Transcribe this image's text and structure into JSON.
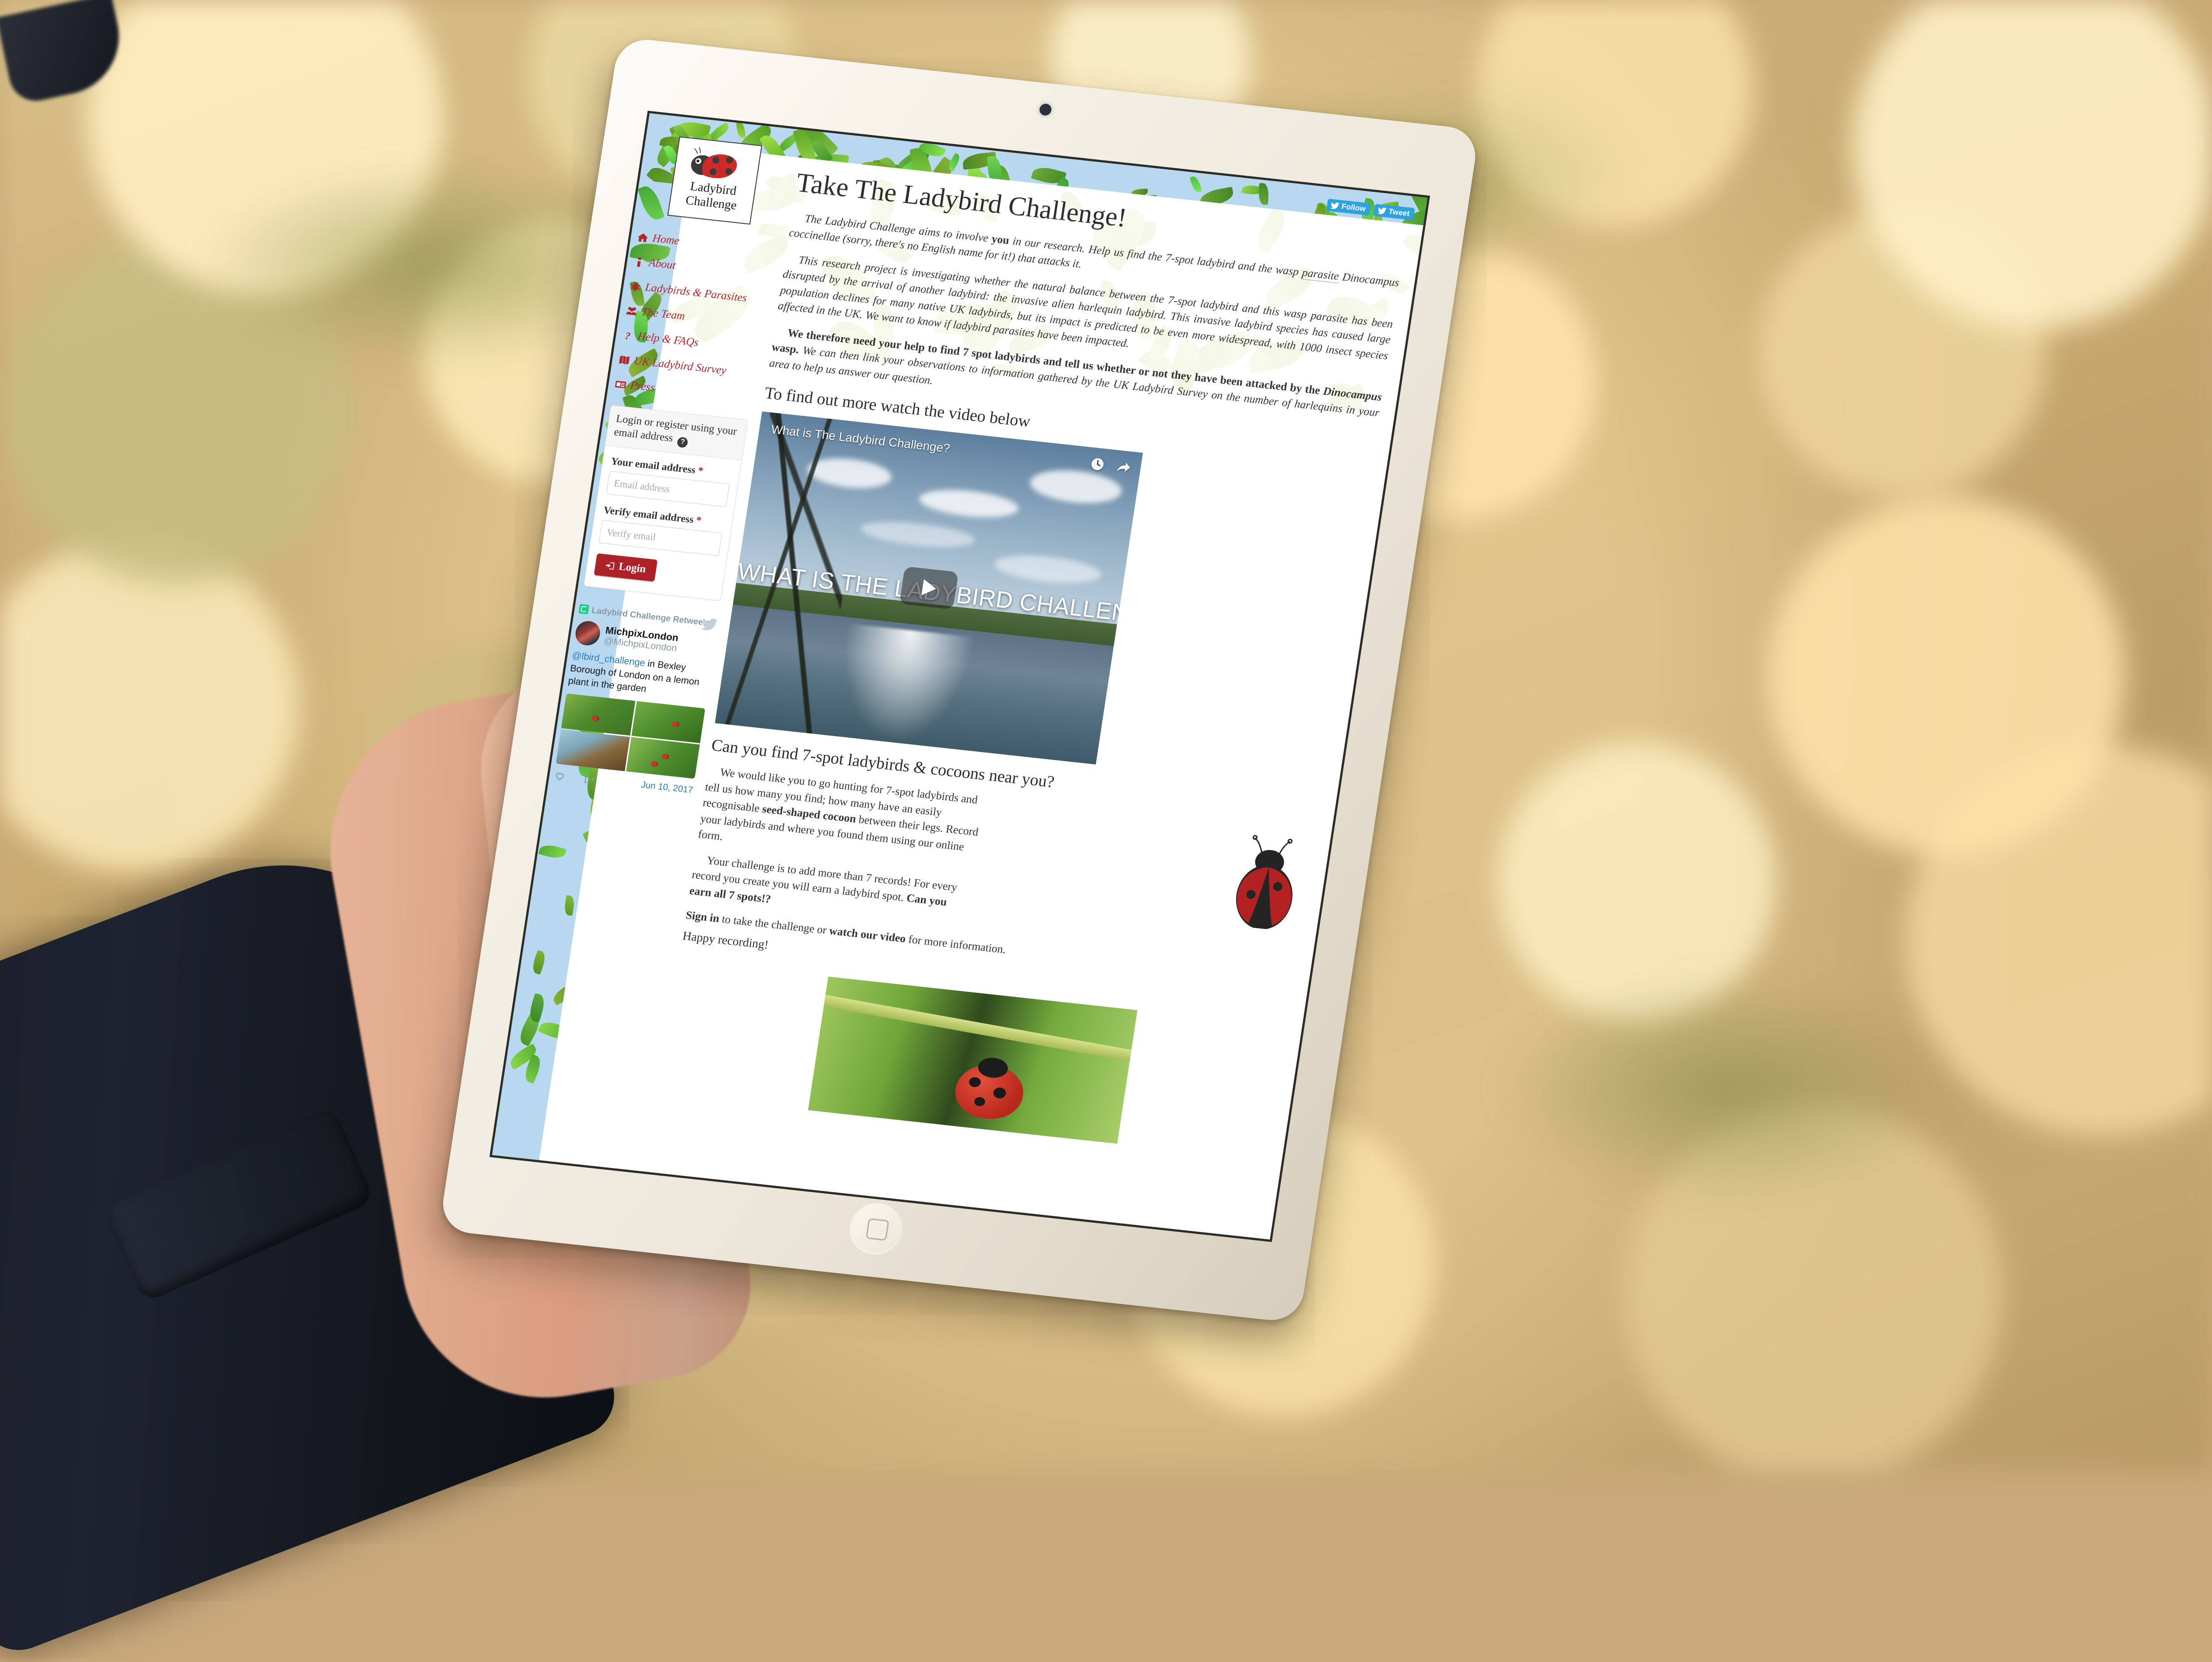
{
  "device": {
    "type": "tablet",
    "orientation": "portrait",
    "bezel_color": "#f1ebe0"
  },
  "site": {
    "logo": {
      "line1": "Ladybird",
      "line2": "Challenge",
      "alt": "ladybird-logo"
    },
    "social": {
      "follow_label": "Follow",
      "tweet_label": "Tweet",
      "button_color": "#2ca3e0"
    },
    "nav": [
      {
        "icon": "home-icon",
        "label": "Home"
      },
      {
        "icon": "info-icon",
        "label": "About"
      },
      {
        "icon": "bug-icon",
        "label": "Ladybirds & Parasites"
      },
      {
        "icon": "users-icon",
        "label": "The Team"
      },
      {
        "icon": "question-icon",
        "label": "Help & FAQs"
      },
      {
        "icon": "map-icon",
        "label": "UK Ladybird Survey"
      },
      {
        "icon": "newspaper-icon",
        "label": "Press"
      }
    ],
    "login": {
      "heading": "Login or register using your email address",
      "help_icon": "question-circle-icon",
      "email_label": "Your email address",
      "email_placeholder": "Email address",
      "verify_label": "Verify email address",
      "verify_placeholder": "Verify email",
      "required_marker": "*",
      "button_label": "Login",
      "button_color": "#ad2229"
    },
    "twitter_widget": {
      "retweet_line": "Ladybird Challenge Retweeted",
      "author_name": "MichpixLondon",
      "author_handle": "@MichpixLondon",
      "mention": "@lbird_challenge",
      "tweet_text": " in Bexley Borough of London on a lemon plant in the garden",
      "date": "Jun 10, 2017",
      "photo_count": 4
    },
    "main": {
      "title": "Take The Ladybird Challenge!",
      "para1_a": "The Ladybird Challenge aims to involve ",
      "para1_you": "you",
      "para1_b": " in our research. Help us find the 7-spot ladybird and the wasp ",
      "para1_parasite": "parasite",
      "para1_c": " ",
      "para1_species": "Dinocampus coccinellae",
      "para1_d": " (sorry, there's no English name for it!) that attacks it.",
      "para2": "This research project is investigating whether the natural balance between the 7-spot ladybird and this wasp parasite has been disrupted by the arrival of another ladybird: the invasive alien harlequin ladybird. This invasive ladybird species has caused large population declines for many native UK ladybirds, but its impact is predicted to be even more widespread, with 1000 insect species affected in the UK. We want to know if ladybird parasites have been impacted.",
      "para3_bold_a": "We therefore need your help to find 7 spot ladybirds and tell us whether or not they have been attacked by the ",
      "para3_bold_species": "Dinocampus",
      "para3_bold_b": " wasp.",
      "para3_rest": " We can then link your observations to information gathered by the UK Ladybird Survey on the number of harlequins in your area to help us answer our question.",
      "video_heading": "To find out more watch the video below",
      "video": {
        "title": "What is The Ladybird Challenge?",
        "overlay_text": "WHAT IS THE LADYBIRD CHALLENGE?",
        "watch_later_icon": "clock-icon",
        "share_icon": "share-icon",
        "play_icon": "play-icon"
      },
      "lower_heading": "Can you find 7-spot ladybirds & cocoons near you?",
      "lower_p1_a": "We would like you to go hunting for 7-spot ladybirds and tell us how many you find; how many have an easily recognisable ",
      "lower_p1_bold": "seed-shaped cocoon",
      "lower_p1_b": " between their legs. Record your ladybirds and where you found them using our online form.",
      "lower_p2_a": "Your challenge is to add more than 7 records! For every record you create you will earn a ladybird spot. ",
      "lower_p2_bold": "Can you earn all 7 spots!?",
      "signin_bold": "Sign in",
      "signin_mid": " to take the challenge or ",
      "signin_link": "watch our video",
      "signin_end": " for more information.",
      "happy": "Happy recording!"
    }
  }
}
